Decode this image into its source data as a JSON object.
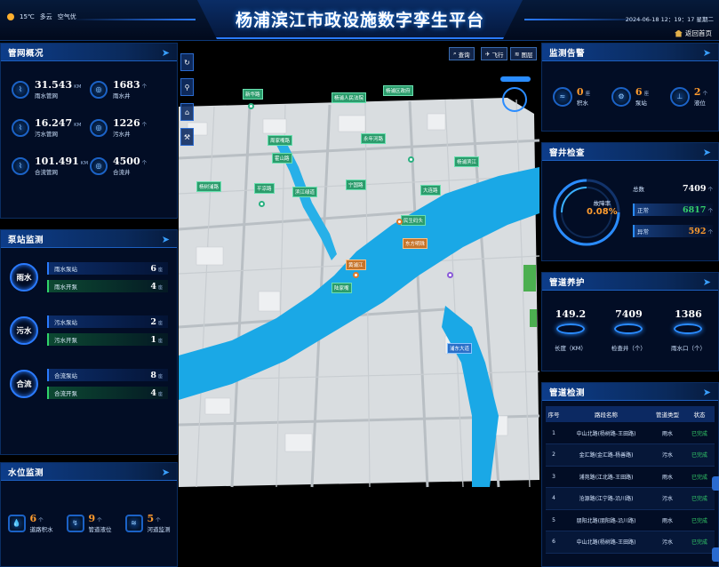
{
  "header": {
    "title": "杨浦滨江市政设施数字孪生平台",
    "weather_temp": "15℃",
    "weather_desc": "多云",
    "air_quality": "空气优",
    "datetime": "2024-06-18 12：19：17 星期二",
    "home_label": "返回首页"
  },
  "pipe_overview": {
    "title": "管网概况",
    "items": [
      {
        "value": "31.543",
        "unit": "KM",
        "label": "雨水管网"
      },
      {
        "value": "1683",
        "unit": "个",
        "label": "雨水井"
      },
      {
        "value": "16.247",
        "unit": "KM",
        "label": "污水管网"
      },
      {
        "value": "1226",
        "unit": "个",
        "label": "污水井"
      },
      {
        "value": "101.491",
        "unit": "KM",
        "label": "合流管网"
      },
      {
        "value": "4500",
        "unit": "个",
        "label": "合流井"
      }
    ]
  },
  "pump_station": {
    "title": "泵站监测",
    "groups": [
      {
        "name": "雨水",
        "rows": [
          {
            "label": "雨水泵站",
            "value": "6",
            "unit": "座"
          },
          {
            "label": "雨水开泵",
            "value": "4",
            "unit": "座"
          }
        ]
      },
      {
        "name": "污水",
        "rows": [
          {
            "label": "污水泵站",
            "value": "2",
            "unit": "座"
          },
          {
            "label": "污水开泵",
            "value": "1",
            "unit": "座"
          }
        ]
      },
      {
        "name": "合流",
        "rows": [
          {
            "label": "合流泵站",
            "value": "8",
            "unit": "座"
          },
          {
            "label": "合流开泵",
            "value": "4",
            "unit": "座"
          }
        ]
      }
    ]
  },
  "water_level": {
    "title": "水位监测",
    "items": [
      {
        "value": "6",
        "unit": "个",
        "label": "道路积水"
      },
      {
        "value": "9",
        "unit": "个",
        "label": "管道液位"
      },
      {
        "value": "5",
        "unit": "个",
        "label": "河道监测"
      }
    ]
  },
  "map": {
    "buttons": [
      {
        "label": "查询"
      },
      {
        "label": "飞行"
      },
      {
        "label": "图层"
      }
    ],
    "labels": [
      {
        "text": "新华路",
        "style": "green"
      },
      {
        "text": "杨浦人民法院",
        "style": "blue"
      },
      {
        "text": "杨浦区政府",
        "style": "green"
      },
      {
        "text": "永年河路",
        "style": "green"
      },
      {
        "text": "周家嘴路",
        "style": "green"
      },
      {
        "text": "杨浦滨江",
        "style": "green"
      },
      {
        "text": "杨树浦路",
        "style": "green"
      },
      {
        "text": "霍山路",
        "style": "green"
      },
      {
        "text": "大连路",
        "style": "green"
      },
      {
        "text": "平凉路",
        "style": "green"
      },
      {
        "text": "宁国路",
        "style": "green"
      },
      {
        "text": "黄浦江",
        "style": "orange"
      },
      {
        "text": "民生码头",
        "style": "green"
      },
      {
        "text": "东方明珠",
        "style": "orange"
      },
      {
        "text": "陆家嘴",
        "style": "green"
      },
      {
        "text": "浦东大道",
        "style": "green"
      },
      {
        "text": "滨江绿道",
        "style": "green"
      }
    ]
  },
  "alarm": {
    "title": "监测告警",
    "items": [
      {
        "value": "0",
        "unit": "座",
        "label": "积水"
      },
      {
        "value": "6",
        "unit": "座",
        "label": "泵站"
      },
      {
        "value": "2",
        "unit": "个",
        "label": "液位"
      }
    ]
  },
  "manhole": {
    "title": "窨井检查",
    "rate_label": "故障率",
    "rate_value": "0.08%",
    "total_label": "总数",
    "total_value": "7409",
    "normal_label": "正常",
    "normal_value": "6817",
    "abnormal_label": "异常",
    "abnormal_value": "592",
    "unit": "个",
    "colors": {
      "normal": "#34d06a",
      "abnormal": "#ff9c2e",
      "ring": "#2a8cff"
    }
  },
  "maintenance": {
    "title": "管道养护",
    "items": [
      {
        "value": "149.2",
        "label": "长度（KM）"
      },
      {
        "value": "7409",
        "label": "检查井（个）"
      },
      {
        "value": "1386",
        "label": "雨水口（个）"
      }
    ]
  },
  "pipe_detect": {
    "title": "管道检测",
    "columns": [
      "序号",
      "路段名称",
      "管道类型",
      "状态"
    ],
    "rows": [
      [
        "1",
        "中山北路(杨树路-王田路)",
        "雨水",
        "已完成"
      ],
      [
        "2",
        "金汇路(金汇路-杨善路)",
        "污水",
        "已完成"
      ],
      [
        "3",
        "浦苑路(江北路-王田路)",
        "雨水",
        "已完成"
      ],
      [
        "4",
        "沧源路(江宁路-沿川路)",
        "污水",
        "已完成"
      ],
      [
        "5",
        "朋阳北路(朋阳路-沿川路)",
        "雨水",
        "已完成"
      ],
      [
        "6",
        "中山北路(杨树路-王田路)",
        "污水",
        "已完成"
      ]
    ]
  }
}
